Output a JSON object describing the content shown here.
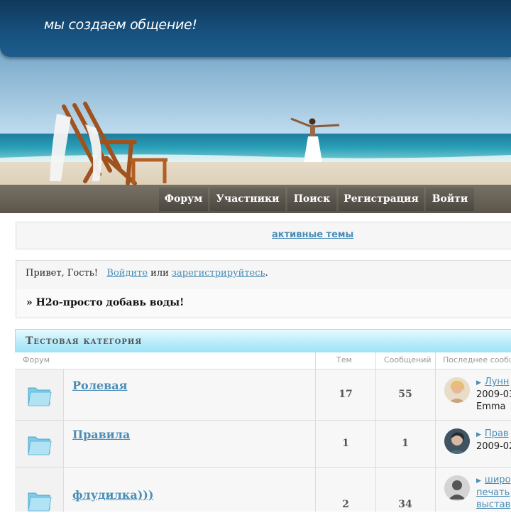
{
  "header": {
    "tagline": "мы создаем общение!"
  },
  "nav": {
    "items": [
      {
        "label": "Форум"
      },
      {
        "label": "Участники"
      },
      {
        "label": "Поиск"
      },
      {
        "label": "Регистрация"
      },
      {
        "label": "Войти"
      }
    ]
  },
  "active_topics": {
    "label": "активные темы"
  },
  "greeting": {
    "hello": "Привет, Гость!",
    "login_link": "Войдите",
    "or": "или",
    "register_link": "зарегистрируйтесь",
    "period": ".",
    "announcement": "» H2o-просто добавь воды!"
  },
  "category": {
    "title": "Тестовая категория",
    "columns": {
      "forum": "Форум",
      "topics": "Тем",
      "posts": "Сообщений",
      "last_post": "Последнее сообщ"
    },
    "rows": [
      {
        "name": "Ролевая",
        "topics": "17",
        "posts": "55",
        "last_link": "Лунн",
        "last_date": "2009-03",
        "last_user": "Emma"
      },
      {
        "name": "Правила",
        "topics": "1",
        "posts": "1",
        "last_link": "Прав",
        "last_date": "2009-02"
      },
      {
        "name": "флудилка)))",
        "topics": "2",
        "posts": "34",
        "last_link": "широ",
        "last_line2": "печать",
        "last_line3": "выстав"
      }
    ]
  },
  "colors": {
    "link": "#4a8db6",
    "header_dark": "#10385c",
    "category_bar": "#b9ecfa"
  }
}
